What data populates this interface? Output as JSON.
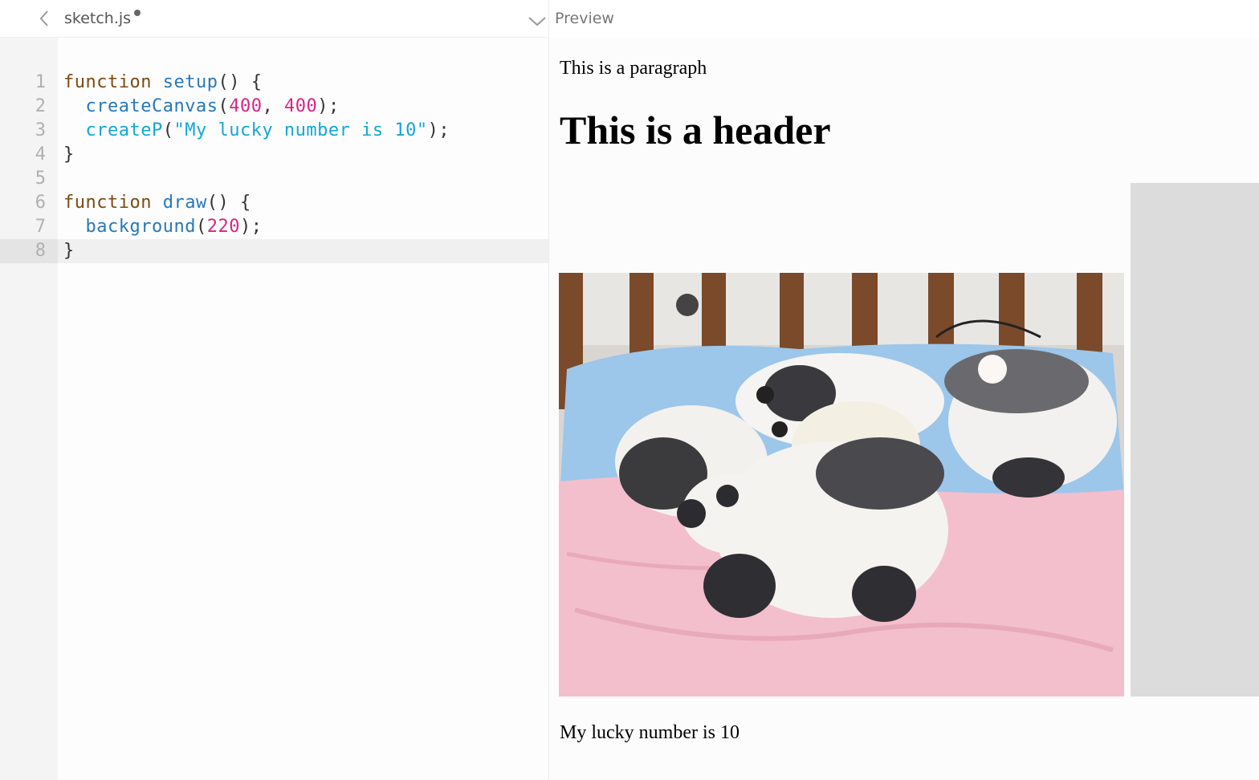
{
  "editor": {
    "file_name": "sketch.js",
    "back_icon": "chevron-left-icon",
    "unsaved_indicator": "unsaved-dot",
    "line_numbers": [
      "1",
      "2",
      "3",
      "4",
      "5",
      "6",
      "7",
      "8"
    ],
    "active_line": 8
  },
  "code": {
    "l1_kw": "function",
    "l1_fn": "setup",
    "l1_rest": "() {",
    "l2_fn": "createCanvas",
    "l2_open": "(",
    "l2_n1": "400",
    "l2_comma": ", ",
    "l2_n2": "400",
    "l2_close": ");",
    "l3_fn": "createP",
    "l3_open": "(",
    "l3_str": "\"My lucky number is 10\"",
    "l3_close": ");",
    "l4": "}",
    "l6_kw": "function",
    "l6_fn": "draw",
    "l6_rest": "() {",
    "l7_fn": "background",
    "l7_open": "(",
    "l7_n": "220",
    "l7_close": ");",
    "l8": "}"
  },
  "preview": {
    "title": "Preview",
    "collapse_icon": "chevron-down-icon",
    "paragraph": "This is a paragraph",
    "header": "This is a header",
    "image_description_icon": "panda-cubs-photo",
    "lucky": "My lucky number is 10"
  },
  "colors": {
    "keyword": "#7a4b12",
    "function": "#2878b8",
    "number": "#d62586",
    "string": "#11a7d3",
    "canvas_background": "#dcdcdc"
  }
}
